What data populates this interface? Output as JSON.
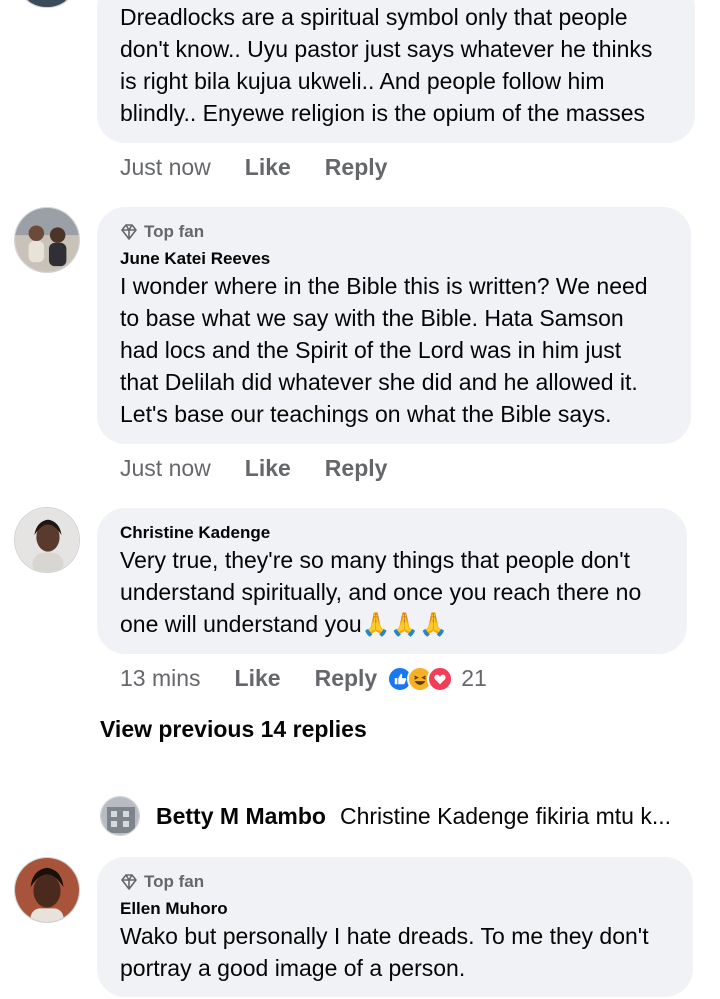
{
  "comments": [
    {
      "text": "Dreadlocks are a spiritual symbol only that people\ndon't know.. Uyu pastor just says whatever he thinks\nis right bila kujua ukweli..  And people follow him\nblindly.. Enyewe religion is the opium of the masses",
      "time": "Just now",
      "like": "Like",
      "reply": "Reply"
    },
    {
      "badge": "Top fan",
      "author": "June Katei Reeves",
      "text": "I wonder where in the Bible this is written? We need\nto base what we say with the Bible. Hata Samson\nhad locs and the Spirit of the Lord was in him just\nthat Delilah did whatever she did and he allowed it.\nLet's base our teachings on what the Bible says.",
      "time": "Just now",
      "like": "Like",
      "reply": "Reply"
    },
    {
      "author": "Christine Kadenge",
      "text": "Very true, they're so many things that people don't\nunderstand spiritually, and once you reach there no\none will understand you",
      "emoji": "🙏🙏🙏",
      "time": "13 mins",
      "like": "Like",
      "reply": "Reply",
      "reactions": [
        "like-icon",
        "haha-icon",
        "love-icon"
      ],
      "reaction_count": "21"
    },
    {
      "badge": "Top fan",
      "author": "Ellen Muhoro",
      "text": "Wako but personally I hate dreads. To me they don't\nportray a good image of a person."
    }
  ],
  "view_previous": "View previous 14 replies",
  "reply_preview": {
    "name": "Betty M Mambo",
    "text": "Christine Kadenge fikiria mtu k..."
  },
  "colors": {
    "bubble": "#f0f2f5",
    "meta": "#65676b",
    "like_blue": "#1877f2",
    "love_red": "#f33e58",
    "haha_yellow": "#f7b125"
  }
}
